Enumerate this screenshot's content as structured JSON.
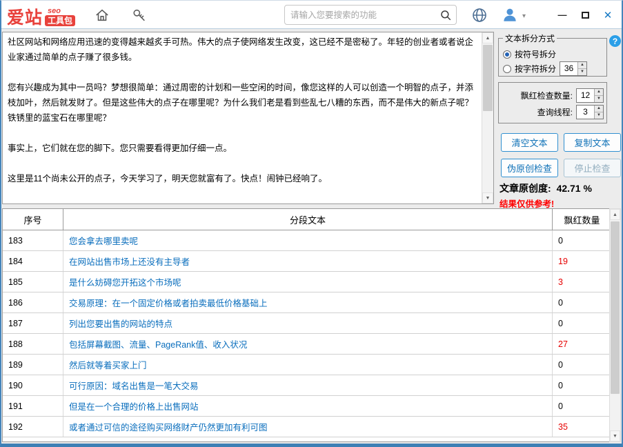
{
  "toolbar": {
    "logo": {
      "brand": "爱站",
      "seo": "seo",
      "suite": "工具包"
    },
    "search": {
      "placeholder": "请输入您要搜索的功能"
    },
    "window": {
      "minimize": "—",
      "close": "✕"
    }
  },
  "icons": {
    "caret_down": "▾",
    "help": "?",
    "spin_up": "▲",
    "spin_down": "▼",
    "scroll_up": "▲",
    "scroll_down": "▼"
  },
  "editor": {
    "paragraphs": [
      "社区网站和网络应用迅速的变得越来越炙手可热。伟大的点子使网络发生改变，这已经不是密秘了。年轻的创业者或者说企业家通过简单的点子赚了很多钱。",
      "您有兴趣成为其中一员吗？梦想很简单：通过周密的计划和一些空闲的时间，像您这样的人可以创造一个明智的点子，并添枝加叶，然后就发财了。但是这些伟大的点子在哪里呢？为什么我们老是看到些乱七八糟的东西，而不是伟大的新点子呢？铁锈里的蓝宝石在哪里呢？",
      "事实上，它们就在您的脚下。您只需要看得更加仔细一点。",
      "这里是11个尚未公开的点子，今天学习了，明天您就富有了。快点！闹钟已经响了。"
    ]
  },
  "panel": {
    "split_group": {
      "title": "文本拆分方式",
      "options": [
        {
          "label": "按符号拆分",
          "checked": true
        },
        {
          "label": "按字符拆分",
          "checked": false
        }
      ],
      "char_split_value": "36"
    },
    "check_count": {
      "label": "飘红检查数量:",
      "value": "12"
    },
    "threads": {
      "label": "查询线程:",
      "value": "3"
    },
    "buttons": {
      "clear": "清空文本",
      "copy": "复制文本",
      "check": "伪原创检查",
      "stop": "停止检查"
    },
    "originality": {
      "label": "文章原创度:",
      "value": "42.71 %"
    },
    "note": "结果仅供参考!"
  },
  "table": {
    "headers": [
      "序号",
      "分段文本",
      "飘红数量"
    ],
    "rows": [
      {
        "id": "183",
        "text": "您会拿去哪里卖呢",
        "count": "0",
        "red": false
      },
      {
        "id": "184",
        "text": "在网站出售市场上还没有主导者",
        "count": "19",
        "red": true
      },
      {
        "id": "185",
        "text": "是什么妨碍您开拓这个市场呢",
        "count": "3",
        "red": true
      },
      {
        "id": "186",
        "text": "交易原理：在一个固定价格或者拍卖最低价格基础上",
        "count": "0",
        "red": false
      },
      {
        "id": "187",
        "text": "列出您要出售的网站的特点",
        "count": "0",
        "red": false
      },
      {
        "id": "188",
        "text": "包括屏幕截图、流量、PageRank值、收入状况",
        "count": "27",
        "red": true
      },
      {
        "id": "189",
        "text": "然后就等着买家上门",
        "count": "0",
        "red": false
      },
      {
        "id": "190",
        "text": "可行原因：域名出售是一笔大交易",
        "count": "0",
        "red": false
      },
      {
        "id": "191",
        "text": "但是在一个合理的价格上出售网站",
        "count": "0",
        "red": false
      },
      {
        "id": "192",
        "text": "或者通过可信的途径购买网络财产仍然更加有利可图",
        "count": "35",
        "red": true
      }
    ]
  }
}
